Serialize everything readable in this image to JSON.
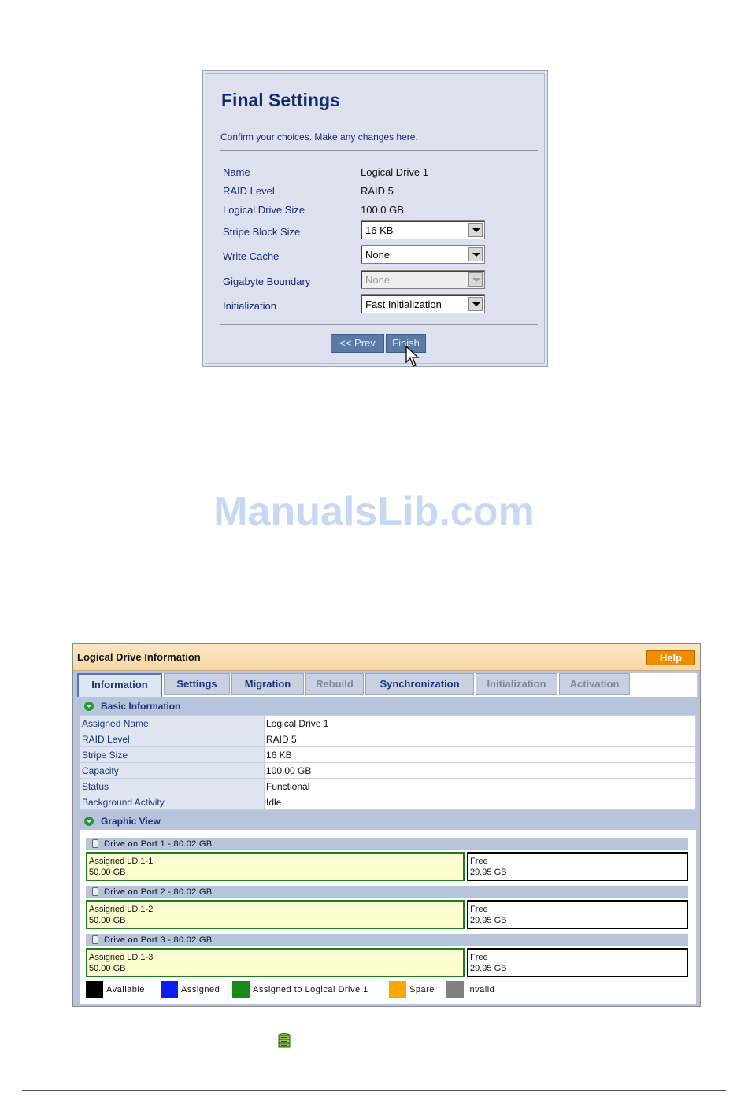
{
  "final_settings": {
    "title": "Final Settings",
    "subtitle": "Confirm your choices. Make any changes here.",
    "fields": [
      {
        "label": "Name",
        "value": "Logical Drive 1"
      },
      {
        "label": "RAID Level",
        "value": "RAID 5"
      },
      {
        "label": "Logical Drive Size",
        "value": "100.0 GB"
      },
      {
        "label": "Stripe Block Size",
        "value": "16 KB"
      },
      {
        "label": "Write Cache",
        "value": "None"
      },
      {
        "label": "Gigabyte Boundary",
        "value": "None"
      },
      {
        "label": "Initialization",
        "value": "Fast Initialization"
      }
    ],
    "prev_label": "<< Prev",
    "finish_label": "Finish"
  },
  "watermark": "ManualsLib.com",
  "logical_drive_info": {
    "title": "Logical Drive Information",
    "help_label": "Help",
    "tabs": [
      "Information",
      "Settings",
      "Migration",
      "Rebuild",
      "Synchronization",
      "Initialization",
      "Activation"
    ],
    "active_tab": "Information",
    "basic_section_label": "Basic Information",
    "rows": [
      {
        "key": "Assigned Name",
        "value": "Logical Drive 1"
      },
      {
        "key": "RAID Level",
        "value": "RAID 5"
      },
      {
        "key": "Stripe Size",
        "value": "16 KB"
      },
      {
        "key": "Capacity",
        "value": "100.00 GB"
      },
      {
        "key": "Status",
        "value": "Functional"
      },
      {
        "key": "Background Activity",
        "value": "Idle"
      }
    ],
    "graphic_section_label": "Graphic View",
    "drives": [
      {
        "label": "Drive on Port 1 - 80.02 GB",
        "ld_name": "Assigned LD 1-1",
        "ld_size": "50.00 GB",
        "free_label": "Free",
        "free_size": "29.95 GB"
      },
      {
        "label": "Drive on Port 2 - 80.02 GB",
        "ld_name": "Assigned LD 1-2",
        "ld_size": "50.00 GB",
        "free_label": "Free",
        "free_size": "29.95 GB"
      },
      {
        "label": "Drive on Port 3 - 80.02 GB",
        "ld_name": "Assigned LD 1-3",
        "ld_size": "50.00 GB",
        "free_label": "Free",
        "free_size": "29.95 GB"
      }
    ],
    "legend": [
      {
        "label": "Available",
        "color": "#000000"
      },
      {
        "label": "Assigned",
        "color": "#0a1ef0"
      },
      {
        "label": "Assigned to Logical Drive 1",
        "color": "#168a16"
      },
      {
        "label": "Spare",
        "color": "#f7a600"
      },
      {
        "label": "Invalid",
        "color": "#808080"
      }
    ]
  },
  "footer_icon": "database-icon"
}
